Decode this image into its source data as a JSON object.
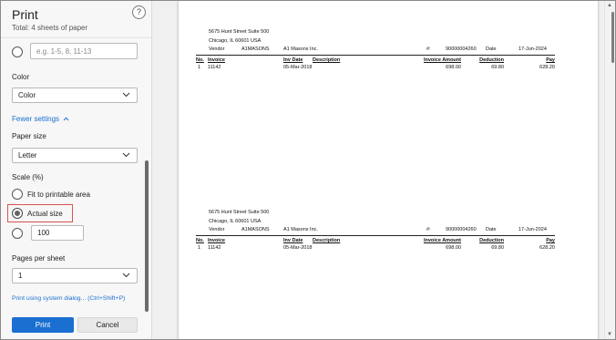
{
  "dialog": {
    "title": "Print",
    "subtitle": "Total: 4 sheets of paper",
    "help": "?",
    "pages_custom_placeholder": "e.g. 1-5, 8, 11-13",
    "color_label": "Color",
    "color_value": "Color",
    "fewer_settings": "Fewer settings",
    "paper_size_label": "Paper size",
    "paper_size_value": "Letter",
    "scale_label": "Scale (%)",
    "scale_options": [
      "Fit to printable area",
      "Actual size"
    ],
    "scale_custom_value": "100",
    "pages_per_sheet_label": "Pages per sheet",
    "pages_per_sheet_value": "1",
    "system_dialog_link": "Print using system dialog... (Ctrl+Shift+P)",
    "print_button": "Print",
    "cancel_button": "Cancel"
  },
  "stubs": [
    {
      "address1": "5675 Hunt Street Suite 500",
      "address2": "Chicago, IL 60601 USA",
      "vendor_label": "Vendor",
      "vendor_code": "A1MASONS",
      "vendor_name": "A1 Masons Inc.",
      "num_label": "#:",
      "num_value": "90000004260",
      "date_label": "Date",
      "date_value": "17-Jun-2024",
      "headers": [
        "No.",
        "Invoice",
        "Inv Date",
        "Description",
        "Invoice Amount",
        "Deduction",
        "Pay"
      ],
      "row": [
        "1",
        "11142",
        "05-Mar-2018",
        "",
        "698.00",
        "69.80",
        "628.20"
      ]
    },
    {
      "address1": "5675 Hunt Street Suite 500",
      "address2": "Chicago, IL 60601 USA",
      "vendor_label": "Vendor",
      "vendor_code": "A1MASONS",
      "vendor_name": "A1 Masons Inc.",
      "num_label": "#:",
      "num_value": "90000004260",
      "date_label": "Date",
      "date_value": "17-Jun-2024",
      "headers": [
        "No.",
        "Invoice",
        "Inv Date",
        "Description",
        "Invoice Amount",
        "Deduction",
        "Pay"
      ],
      "row": [
        "1",
        "11142",
        "05-Mar-2018",
        "",
        "698.00",
        "69.80",
        "628.20"
      ]
    }
  ]
}
